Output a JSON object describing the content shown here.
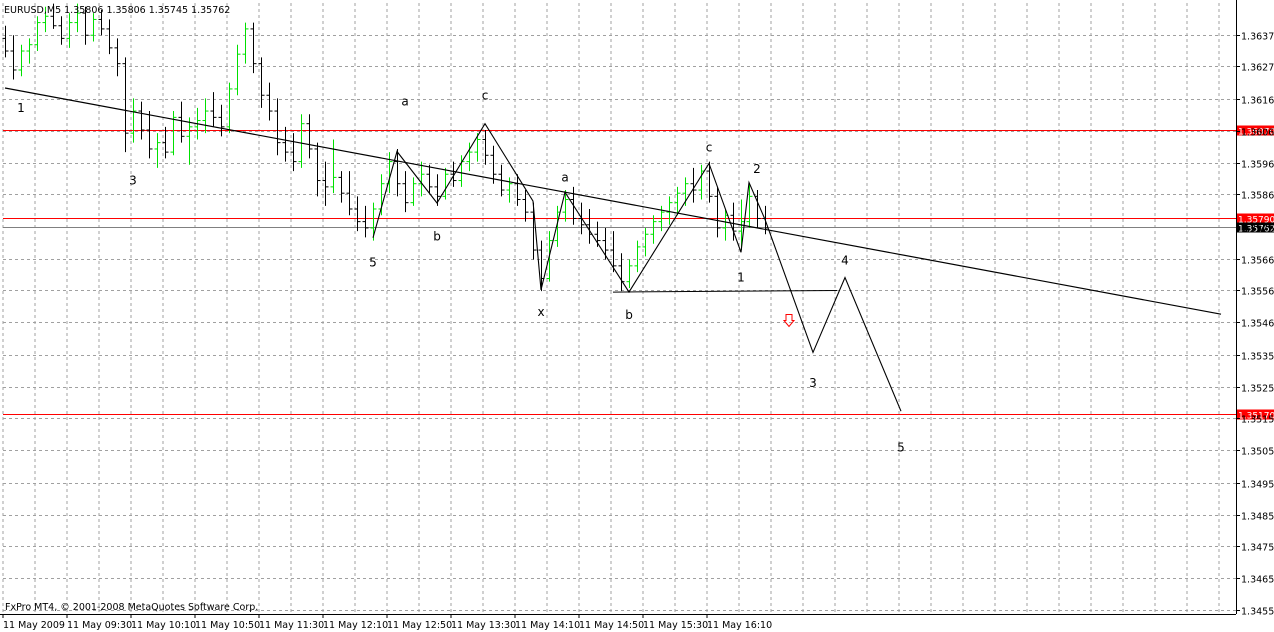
{
  "header": {
    "symbol": "EURUSD,M5",
    "open": "1.35806",
    "high": "1.35806",
    "low": "1.35745",
    "close": "1.35762"
  },
  "copyright": "FxPro MT4, © 2001-2008 MetaQuotes Software Corp.",
  "colors": {
    "background": "#ffffff",
    "grid": "#a0a0a0",
    "bull_bar": "#00e000",
    "bear_bar": "#000000",
    "level_line": "#ff0000",
    "level_label_bg": "#ff0000",
    "current_label_bg": "#000000",
    "drawing": "#000000",
    "arrow": "#ff0000"
  },
  "chart_data": {
    "type": "ohlc",
    "title": "EURUSD,M5",
    "y_ticks": [
      "1.36372",
      "1.36272",
      "1.36167",
      "1.36067",
      "1.35967",
      "1.35867",
      "1.35762",
      "1.35662",
      "1.35562",
      "1.35462",
      "1.35357",
      "1.35257",
      "1.35157",
      "1.35057",
      "1.34952",
      "1.34852",
      "1.34752",
      "1.34652",
      "1.34552"
    ],
    "x_ticks": [
      "11 May 2009",
      "11 May 09:30",
      "11 May 10:10",
      "11 May 10:50",
      "11 May 11:30",
      "11 May 12:10",
      "11 May 12:50",
      "11 May 13:30",
      "11 May 14:10",
      "11 May 14:50",
      "11 May 15:30",
      "11 May 16:10"
    ],
    "ylim": [
      1.34538,
      1.36472
    ],
    "grid": true,
    "levels": [
      {
        "price": 1.3607,
        "label": "1.36070",
        "style": "red-label"
      },
      {
        "price": 1.3579,
        "label": "1.35790",
        "style": "red-label"
      },
      {
        "price": 1.35762,
        "label": "1.35762",
        "style": "current"
      },
      {
        "price": 1.3517,
        "label": "1.35170",
        "style": "red-label"
      }
    ],
    "trendline": {
      "from": {
        "bar": 0,
        "price": 1.36203
      },
      "to": {
        "bar": 152,
        "price": 1.35487
      }
    },
    "support_line": {
      "from": {
        "bar": 76,
        "price": 1.35557
      },
      "to": {
        "bar": 104,
        "price": 1.35562
      }
    },
    "wave_path": [
      {
        "bar": 46,
        "price": 1.35729
      },
      {
        "bar": 49,
        "price": 1.36002
      },
      {
        "bar": 54,
        "price": 1.35839
      },
      {
        "bar": 60,
        "price": 1.3609
      },
      {
        "bar": 66,
        "price": 1.35845
      },
      {
        "bar": 67,
        "price": 1.35564
      },
      {
        "bar": 70,
        "price": 1.35873
      },
      {
        "bar": 78,
        "price": 1.35557
      },
      {
        "bar": 88,
        "price": 1.35964
      },
      {
        "bar": 92,
        "price": 1.35683
      },
      {
        "bar": 93,
        "price": 1.35904
      },
      {
        "bar": 95,
        "price": 1.35787
      },
      {
        "bar": 101,
        "price": 1.35366
      },
      {
        "bar": 105,
        "price": 1.35603
      },
      {
        "bar": 112,
        "price": 1.3518
      }
    ],
    "wave_labels": [
      {
        "text": "1",
        "bar": 2,
        "price": 1.36127
      },
      {
        "text": "3",
        "bar": 16,
        "price": 1.35897
      },
      {
        "text": "5",
        "bar": 46,
        "price": 1.35638
      },
      {
        "text": "a",
        "bar": 50,
        "price": 1.36147
      },
      {
        "text": "b",
        "bar": 54,
        "price": 1.3572
      },
      {
        "text": "c",
        "bar": 60,
        "price": 1.36167
      },
      {
        "text": "x",
        "bar": 67,
        "price": 1.35482
      },
      {
        "text": "a",
        "bar": 70,
        "price": 1.35907
      },
      {
        "text": "b",
        "bar": 78,
        "price": 1.35472
      },
      {
        "text": "c",
        "bar": 88,
        "price": 1.36002
      },
      {
        "text": "2",
        "bar": 94,
        "price": 1.35934
      },
      {
        "text": "1",
        "bar": 92,
        "price": 1.35591
      },
      {
        "text": "4",
        "bar": 105,
        "price": 1.35644
      },
      {
        "text": "3",
        "bar": 101,
        "price": 1.35257
      },
      {
        "text": "5",
        "bar": 112,
        "price": 1.35052
      }
    ],
    "arrow": {
      "bar": 98,
      "price": 1.35467,
      "direction": "down"
    },
    "bars": [
      {
        "o": 1.3636,
        "h": 1.364,
        "l": 1.363,
        "c": 1.3632
      },
      {
        "o": 1.3632,
        "h": 1.3637,
        "l": 1.3623,
        "c": 1.3626
      },
      {
        "o": 1.3626,
        "h": 1.3634,
        "l": 1.3624,
        "c": 1.3632
      },
      {
        "o": 1.3632,
        "h": 1.3636,
        "l": 1.3628,
        "c": 1.3634
      },
      {
        "o": 1.3634,
        "h": 1.3643,
        "l": 1.3632,
        "c": 1.3641
      },
      {
        "o": 1.3641,
        "h": 1.3646,
        "l": 1.3638,
        "c": 1.3643
      },
      {
        "o": 1.3643,
        "h": 1.3647,
        "l": 1.3639,
        "c": 1.364
      },
      {
        "o": 1.364,
        "h": 1.3643,
        "l": 1.3634,
        "c": 1.3636
      },
      {
        "o": 1.3636,
        "h": 1.3644,
        "l": 1.3633,
        "c": 1.3641
      },
      {
        "o": 1.3641,
        "h": 1.3647,
        "l": 1.3638,
        "c": 1.3644
      },
      {
        "o": 1.3644,
        "h": 1.3646,
        "l": 1.3634,
        "c": 1.3637
      },
      {
        "o": 1.3637,
        "h": 1.3644,
        "l": 1.3635,
        "c": 1.3642
      },
      {
        "o": 1.3642,
        "h": 1.3645,
        "l": 1.3637,
        "c": 1.3639
      },
      {
        "o": 1.3639,
        "h": 1.3642,
        "l": 1.3631,
        "c": 1.3633
      },
      {
        "o": 1.3633,
        "h": 1.3636,
        "l": 1.3624,
        "c": 1.3628
      },
      {
        "o": 1.3628,
        "h": 1.363,
        "l": 1.36,
        "c": 1.3606
      },
      {
        "o": 1.3606,
        "h": 1.3617,
        "l": 1.3603,
        "c": 1.3613
      },
      {
        "o": 1.3613,
        "h": 1.3616,
        "l": 1.3604,
        "c": 1.3607
      },
      {
        "o": 1.3607,
        "h": 1.3613,
        "l": 1.3598,
        "c": 1.3601
      },
      {
        "o": 1.3601,
        "h": 1.3606,
        "l": 1.3595,
        "c": 1.3603
      },
      {
        "o": 1.3603,
        "h": 1.3608,
        "l": 1.3598,
        "c": 1.36
      },
      {
        "o": 1.36,
        "h": 1.3613,
        "l": 1.3599,
        "c": 1.3611
      },
      {
        "o": 1.3611,
        "h": 1.3616,
        "l": 1.3603,
        "c": 1.3605
      },
      {
        "o": 1.3605,
        "h": 1.3611,
        "l": 1.3596,
        "c": 1.3608
      },
      {
        "o": 1.3608,
        "h": 1.3614,
        "l": 1.3604,
        "c": 1.361
      },
      {
        "o": 1.361,
        "h": 1.3617,
        "l": 1.3606,
        "c": 1.3613
      },
      {
        "o": 1.3613,
        "h": 1.3619,
        "l": 1.3608,
        "c": 1.3611
      },
      {
        "o": 1.3611,
        "h": 1.3615,
        "l": 1.3605,
        "c": 1.3608
      },
      {
        "o": 1.3608,
        "h": 1.3622,
        "l": 1.3606,
        "c": 1.362
      },
      {
        "o": 1.362,
        "h": 1.3634,
        "l": 1.3618,
        "c": 1.3631
      },
      {
        "o": 1.3631,
        "h": 1.3641,
        "l": 1.3628,
        "c": 1.3639
      },
      {
        "o": 1.3639,
        "h": 1.3641,
        "l": 1.3625,
        "c": 1.3628
      },
      {
        "o": 1.3628,
        "h": 1.363,
        "l": 1.3614,
        "c": 1.3618
      },
      {
        "o": 1.3618,
        "h": 1.3622,
        "l": 1.361,
        "c": 1.3613
      },
      {
        "o": 1.3613,
        "h": 1.3617,
        "l": 1.3599,
        "c": 1.3603
      },
      {
        "o": 1.3603,
        "h": 1.3608,
        "l": 1.3597,
        "c": 1.36
      },
      {
        "o": 1.36,
        "h": 1.3606,
        "l": 1.3594,
        "c": 1.3597
      },
      {
        "o": 1.3597,
        "h": 1.3612,
        "l": 1.3595,
        "c": 1.3609
      },
      {
        "o": 1.3609,
        "h": 1.3612,
        "l": 1.3598,
        "c": 1.3601
      },
      {
        "o": 1.3601,
        "h": 1.3603,
        "l": 1.3586,
        "c": 1.3591
      },
      {
        "o": 1.3591,
        "h": 1.3597,
        "l": 1.3583,
        "c": 1.3589
      },
      {
        "o": 1.3589,
        "h": 1.3604,
        "l": 1.3587,
        "c": 1.3592
      },
      {
        "o": 1.3592,
        "h": 1.3594,
        "l": 1.3584,
        "c": 1.3587
      },
      {
        "o": 1.3587,
        "h": 1.3594,
        "l": 1.358,
        "c": 1.3582
      },
      {
        "o": 1.3582,
        "h": 1.3586,
        "l": 1.3575,
        "c": 1.3578
      },
      {
        "o": 1.3578,
        "h": 1.3583,
        "l": 1.3573,
        "c": 1.3576
      },
      {
        "o": 1.3576,
        "h": 1.3584,
        "l": 1.3572,
        "c": 1.3582
      },
      {
        "o": 1.3582,
        "h": 1.3593,
        "l": 1.358,
        "c": 1.359
      },
      {
        "o": 1.359,
        "h": 1.36,
        "l": 1.3587,
        "c": 1.3597
      },
      {
        "o": 1.3597,
        "h": 1.3601,
        "l": 1.3586,
        "c": 1.359
      },
      {
        "o": 1.359,
        "h": 1.3594,
        "l": 1.3581,
        "c": 1.3584
      },
      {
        "o": 1.3584,
        "h": 1.3592,
        "l": 1.3583,
        "c": 1.359
      },
      {
        "o": 1.359,
        "h": 1.3597,
        "l": 1.3586,
        "c": 1.3593
      },
      {
        "o": 1.3593,
        "h": 1.3596,
        "l": 1.3587,
        "c": 1.3589
      },
      {
        "o": 1.3589,
        "h": 1.3593,
        "l": 1.3583,
        "c": 1.3586
      },
      {
        "o": 1.3586,
        "h": 1.3595,
        "l": 1.3585,
        "c": 1.3593
      },
      {
        "o": 1.3593,
        "h": 1.3597,
        "l": 1.3589,
        "c": 1.3591
      },
      {
        "o": 1.3591,
        "h": 1.3599,
        "l": 1.3589,
        "c": 1.3597
      },
      {
        "o": 1.3597,
        "h": 1.3603,
        "l": 1.3594,
        "c": 1.36
      },
      {
        "o": 1.36,
        "h": 1.3606,
        "l": 1.3597,
        "c": 1.3604
      },
      {
        "o": 1.3604,
        "h": 1.3607,
        "l": 1.3596,
        "c": 1.3599
      },
      {
        "o": 1.3599,
        "h": 1.3602,
        "l": 1.359,
        "c": 1.3593
      },
      {
        "o": 1.3593,
        "h": 1.3596,
        "l": 1.3586,
        "c": 1.3588
      },
      {
        "o": 1.3588,
        "h": 1.3592,
        "l": 1.3584,
        "c": 1.359
      },
      {
        "o": 1.359,
        "h": 1.3593,
        "l": 1.3583,
        "c": 1.3585
      },
      {
        "o": 1.3585,
        "h": 1.3588,
        "l": 1.3578,
        "c": 1.3581
      },
      {
        "o": 1.3581,
        "h": 1.3584,
        "l": 1.3566,
        "c": 1.3569
      },
      {
        "o": 1.3569,
        "h": 1.3572,
        "l": 1.3556,
        "c": 1.356
      },
      {
        "o": 1.356,
        "h": 1.3575,
        "l": 1.3559,
        "c": 1.3572
      },
      {
        "o": 1.3572,
        "h": 1.3583,
        "l": 1.357,
        "c": 1.3581
      },
      {
        "o": 1.3581,
        "h": 1.3588,
        "l": 1.3578,
        "c": 1.3585
      },
      {
        "o": 1.3585,
        "h": 1.3589,
        "l": 1.3577,
        "c": 1.3579
      },
      {
        "o": 1.3579,
        "h": 1.3584,
        "l": 1.3574,
        "c": 1.3577
      },
      {
        "o": 1.3577,
        "h": 1.3582,
        "l": 1.3571,
        "c": 1.3574
      },
      {
        "o": 1.3574,
        "h": 1.3578,
        "l": 1.357,
        "c": 1.3572
      },
      {
        "o": 1.3572,
        "h": 1.3576,
        "l": 1.3566,
        "c": 1.3569
      },
      {
        "o": 1.3569,
        "h": 1.3575,
        "l": 1.3562,
        "c": 1.3564
      },
      {
        "o": 1.3564,
        "h": 1.3568,
        "l": 1.3556,
        "c": 1.3559
      },
      {
        "o": 1.3559,
        "h": 1.3566,
        "l": 1.3557,
        "c": 1.3564
      },
      {
        "o": 1.3564,
        "h": 1.3572,
        "l": 1.3562,
        "c": 1.357
      },
      {
        "o": 1.357,
        "h": 1.3576,
        "l": 1.3567,
        "c": 1.3574
      },
      {
        "o": 1.3574,
        "h": 1.358,
        "l": 1.3571,
        "c": 1.3578
      },
      {
        "o": 1.3578,
        "h": 1.3583,
        "l": 1.3575,
        "c": 1.3581
      },
      {
        "o": 1.3581,
        "h": 1.3586,
        "l": 1.3577,
        "c": 1.3584
      },
      {
        "o": 1.3584,
        "h": 1.3589,
        "l": 1.358,
        "c": 1.3587
      },
      {
        "o": 1.3587,
        "h": 1.3592,
        "l": 1.3583,
        "c": 1.359
      },
      {
        "o": 1.359,
        "h": 1.3595,
        "l": 1.3584,
        "c": 1.3588
      },
      {
        "o": 1.3588,
        "h": 1.3596,
        "l": 1.3585,
        "c": 1.3594
      },
      {
        "o": 1.3594,
        "h": 1.3597,
        "l": 1.3584,
        "c": 1.3586
      },
      {
        "o": 1.3586,
        "h": 1.3589,
        "l": 1.3573,
        "c": 1.3576
      },
      {
        "o": 1.3576,
        "h": 1.3582,
        "l": 1.3572,
        "c": 1.358
      },
      {
        "o": 1.358,
        "h": 1.3584,
        "l": 1.3572,
        "c": 1.3575
      },
      {
        "o": 1.3575,
        "h": 1.3585,
        "l": 1.3569,
        "c": 1.3578
      },
      {
        "o": 1.3578,
        "h": 1.359,
        "l": 1.3576,
        "c": 1.3586
      },
      {
        "o": 1.3586,
        "h": 1.3588,
        "l": 1.3576,
        "c": 1.3579
      },
      {
        "o": 1.3579,
        "h": 1.3583,
        "l": 1.3574,
        "c": 1.3576
      }
    ]
  }
}
